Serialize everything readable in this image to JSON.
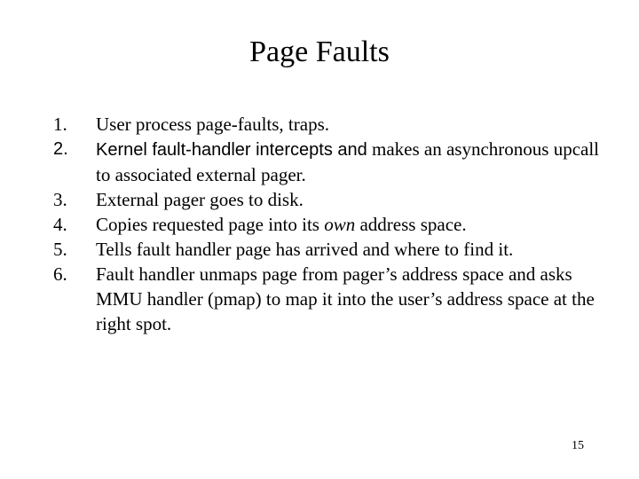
{
  "slide": {
    "title": "Page Faults",
    "page_number": "15",
    "items": [
      {
        "num": "1.",
        "text": "User process page-faults, traps."
      },
      {
        "num": "2.",
        "text_sans": "Kernel fault-handler intercepts and",
        "text_serif": " makes an asynchronous upcall to associated external pager."
      },
      {
        "num": "3.",
        "text": "External pager goes to disk."
      },
      {
        "num": "4.",
        "text_before": "Copies requested page into its ",
        "text_italic": "own",
        "text_after": " address space."
      },
      {
        "num": "5.",
        "text": "Tells fault handler page has arrived and where to find it."
      },
      {
        "num": "6.",
        "text": "Fault handler unmaps page from pager’s address space and asks MMU handler (pmap) to map it into the user’s address space at the right spot."
      }
    ]
  }
}
